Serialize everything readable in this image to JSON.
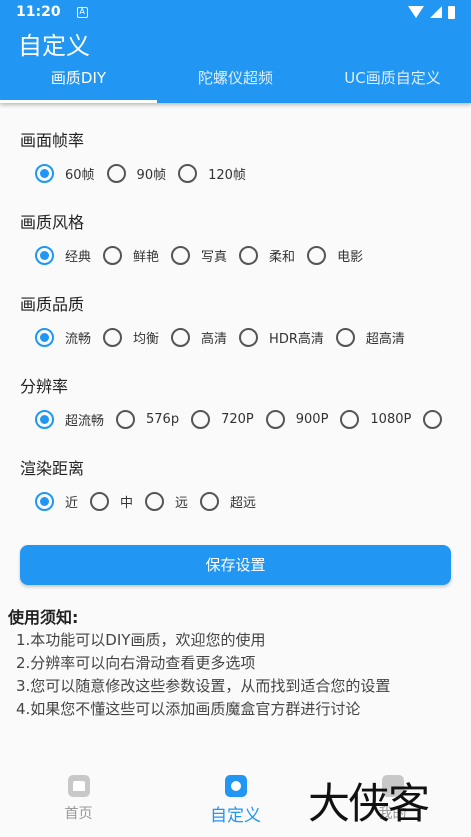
{
  "status_bar": {
    "time": "11:20",
    "notification_icon": "A"
  },
  "app_bar": {
    "title": "自定义"
  },
  "tabs": [
    {
      "label": "画质DIY",
      "active": true
    },
    {
      "label": "陀螺仪超频",
      "active": false
    },
    {
      "label": "UC画质自定义",
      "active": false
    }
  ],
  "sections": [
    {
      "title": "画面帧率",
      "options": [
        "60帧",
        "90帧",
        "120帧"
      ],
      "selected": 0
    },
    {
      "title": "画质风格",
      "options": [
        "经典",
        "鲜艳",
        "写真",
        "柔和",
        "电影"
      ],
      "selected": 0
    },
    {
      "title": "画质品质",
      "options": [
        "流畅",
        "均衡",
        "高清",
        "HDR高清",
        "超高清"
      ],
      "selected": 0
    },
    {
      "title": "分辨率",
      "options": [
        "超流畅",
        "576p",
        "720P",
        "900P",
        "1080P",
        ""
      ],
      "selected": 0
    },
    {
      "title": "渲染距离",
      "options": [
        "近",
        "中",
        "远",
        "超远"
      ],
      "selected": 0
    }
  ],
  "save_button": "保存设置",
  "notes": {
    "title": "使用须知:",
    "items": [
      "1.本功能可以DIY画质，欢迎您的使用",
      "2.分辨率可以向右滑动查看更多选项",
      "3.您可以随意修改这些参数设置，从而找到适合您的设置",
      "4.如果您不懂这些可以添加画质魔盒官方群进行讨论"
    ]
  },
  "bottom_nav": [
    {
      "label": "首页",
      "icon": "home-icon",
      "active": false
    },
    {
      "label": "自定义",
      "icon": "customize-icon",
      "active": true
    },
    {
      "label": "我的",
      "icon": "profile-icon",
      "active": false
    }
  ],
  "watermark": "大侠客",
  "colors": {
    "primary": "#2196f3",
    "background": "#fafafa"
  }
}
